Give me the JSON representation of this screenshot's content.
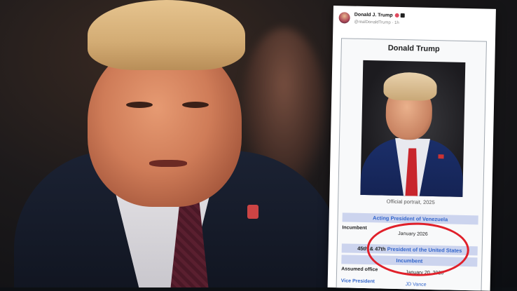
{
  "post": {
    "author": "Donald J. Trump",
    "handle": "@realDonaldTrump · 1h"
  },
  "infobox": {
    "title": "Donald Trump",
    "portrait_caption": "Official portrait, 2025",
    "office1": "Acting President of Venezuela",
    "office1_status_label": "Incumbent",
    "office1_since": "January 2026",
    "office2_prefix": "45th & 47th",
    "office2_link": "President of the United States",
    "office2_status": "Incumbent",
    "assumed_label": "Assumed office",
    "assumed_value": "January 20, 2025",
    "vp_label": "Vice President",
    "vp_value": "JD Vance"
  },
  "colors": {
    "header_row": "#ccd4ee",
    "link": "#3366cc",
    "annotation_circle": "#e0202a"
  }
}
